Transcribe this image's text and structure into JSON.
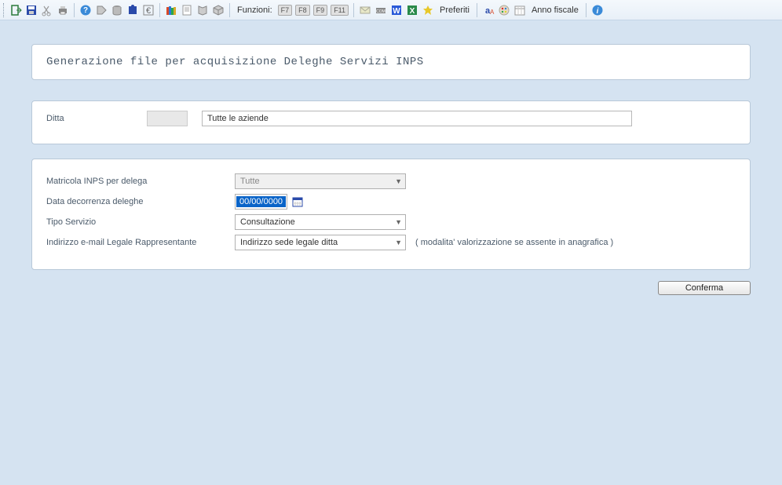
{
  "toolbar": {
    "funzioni_label": "Funzioni:",
    "fkeys": [
      "F7",
      "F8",
      "F9",
      "F11"
    ],
    "preferiti_label": "Preferiti",
    "anno_fiscale_label": "Anno fiscale"
  },
  "title": "Generazione file per acquisizione Deleghe Servizi INPS",
  "form": {
    "ditta_label": "Ditta",
    "ditta_code": "",
    "ditta_name": "Tutte le aziende",
    "matricola_label": "Matricola INPS per delega",
    "matricola_value": "Tutte",
    "data_decorrenza_label": "Data decorrenza deleghe",
    "data_decorrenza_value": "00/00/0000",
    "tipo_servizio_label": "Tipo Servizio",
    "tipo_servizio_value": "Consultazione",
    "indirizzo_email_label": "Indirizzo e-mail Legale Rappresentante",
    "indirizzo_email_value": "Indirizzo sede legale ditta",
    "indirizzo_email_hint": "( modalita' valorizzazione se assente in anagrafica )"
  },
  "buttons": {
    "conferma": "Conferma"
  }
}
